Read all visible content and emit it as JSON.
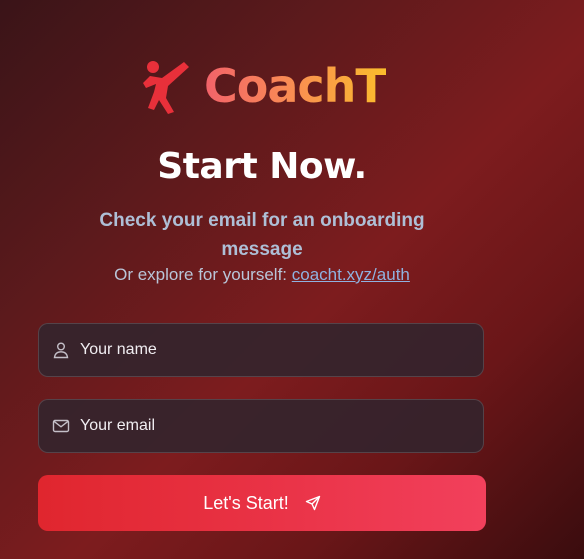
{
  "brand": {
    "name": "CoachT",
    "logo_icon": "martial-arts-kick-icon",
    "gradient": [
      "#f2626a",
      "#f98a55",
      "#fbbd2c"
    ],
    "icon_color": "#e8303a"
  },
  "heading": {
    "title": "Start Now.",
    "subtitle": "Check your email for an onboarding message",
    "explore_prefix": "Or explore for yourself: ",
    "explore_link": "coacht.xyz/auth"
  },
  "form": {
    "name_placeholder": "Your name",
    "name_icon": "user-icon",
    "email_placeholder": "Your email",
    "email_icon": "mail-icon",
    "submit_label": "Let's Start!",
    "submit_icon": "send-icon",
    "submit_color": "#e93245"
  }
}
